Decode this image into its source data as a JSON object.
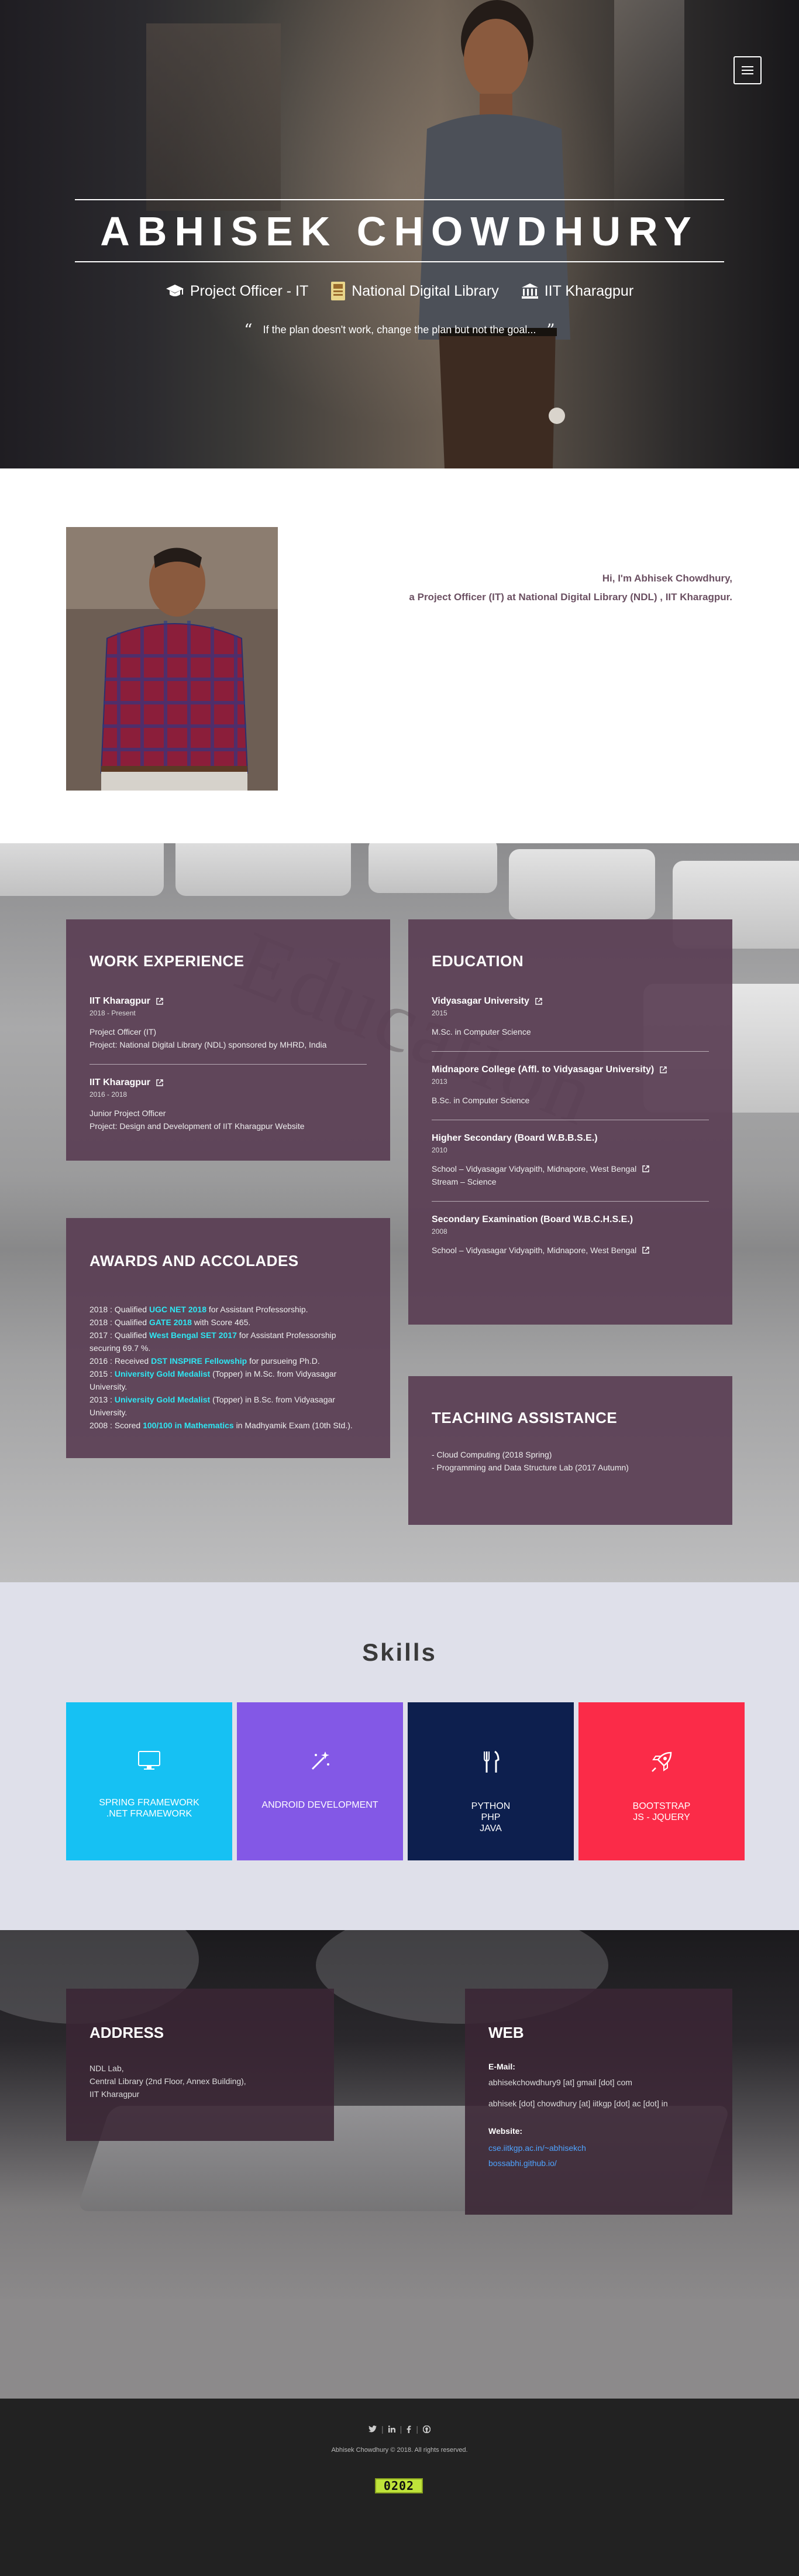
{
  "hero": {
    "name": "ABHISEK CHOWDHURY",
    "roles": [
      {
        "label": "Project Officer - IT",
        "icon": "graduation-cap-icon"
      },
      {
        "label": "National Digital Library",
        "icon": "library-icon"
      },
      {
        "label": "IIT Kharagpur",
        "icon": "university-icon"
      }
    ],
    "quote": "If the plan doesn't work, change the plan but not the goal..."
  },
  "about": {
    "line1": "Hi, I'm Abhisek Chowdhury,",
    "line2": "a Project Officer (IT) at National Digital Library (NDL) , IIT Kharagpur."
  },
  "work": {
    "title": "WORK EXPERIENCE",
    "items": [
      {
        "org": "IIT Kharagpur",
        "date": "2018 - Present",
        "role": "Project Officer (IT)",
        "project": "Project: National Digital Library (NDL) sponsored by MHRD, India"
      },
      {
        "org": "IIT Kharagpur",
        "date": "2016 - 2018",
        "role": "Junior Project Officer",
        "project": "Project: Design and Development of IIT Kharagpur Website"
      }
    ]
  },
  "awards": {
    "title": "AWARDS AND ACCOLADES",
    "items": [
      {
        "pre": "2018 : Qualified ",
        "hl": "UGC NET 2018",
        "post": " for Assistant Professorship."
      },
      {
        "pre": "2018 : Qualified ",
        "hl": "GATE 2018",
        "post": " with Score 465."
      },
      {
        "pre": "2017 : Qualified ",
        "hl": "West Bengal SET 2017",
        "post": " for Assistant Professorship securing 69.7 %."
      },
      {
        "pre": "2016 : Received ",
        "hl": "DST INSPIRE Fellowship",
        "post": " for pursueing Ph.D."
      },
      {
        "pre": "2015 : ",
        "hl": "University Gold Medalist",
        "post": " (Topper) in M.Sc. from Vidyasagar University."
      },
      {
        "pre": "2013 : ",
        "hl": "University Gold Medalist",
        "post": " (Topper) in B.Sc. from Vidyasagar University."
      },
      {
        "pre": "2008 : Scored ",
        "hl": "100/100 in Mathematics",
        "post": " in Madhyamik Exam (10th Std.)."
      }
    ]
  },
  "education": {
    "title": "EDUCATION",
    "items": [
      {
        "school": "Vidyasagar University",
        "year": "2015",
        "line1": "M.Sc. in Computer Science",
        "line2": ""
      },
      {
        "school": "Midnapore College (Affl. to Vidyasagar University)",
        "year": "2013",
        "line1": "B.Sc. in Computer Science",
        "line2": ""
      },
      {
        "school": "Higher Secondary (Board W.B.B.S.E.)",
        "year": "2010",
        "line1": "School – Vidyasagar Vidyapith, Midnapore, West Bengal",
        "line2": "Stream – Science"
      },
      {
        "school": "Secondary Examination (Board W.B.C.H.S.E.)",
        "year": "2008",
        "line1": "School – Vidyasagar Vidyapith, Midnapore, West Bengal",
        "line2": ""
      }
    ]
  },
  "teaching": {
    "title": "TEACHING ASSISTANCE",
    "items": [
      "- Cloud Computing (2018 Spring)",
      "- Programming and Data Structure Lab (2017 Autumn)"
    ]
  },
  "skills": {
    "title": "Skills",
    "items": [
      {
        "icon": "monitor-icon",
        "lines": [
          "SPRING FRAMEWORK",
          ".NET FRAMEWORK"
        ],
        "color": "#16c1f3"
      },
      {
        "icon": "magic-wand-icon",
        "lines": [
          "ANDROID DEVELOPMENT"
        ],
        "color": "#8358e6"
      },
      {
        "icon": "utensils-icon",
        "lines": [
          "PYTHON",
          "PHP",
          "JAVA"
        ],
        "color": "#0d1f4e"
      },
      {
        "icon": "rocket-icon",
        "lines": [
          "BOOTSTRAP",
          "JS - JQUERY"
        ],
        "color": "#fb2b48"
      }
    ]
  },
  "address": {
    "title": "ADDRESS",
    "lines": [
      "NDL Lab,",
      "Central Library (2nd Floor, Annex Building),",
      "IIT Kharagpur"
    ]
  },
  "web": {
    "title": "WEB",
    "email_label": "E-Mail:",
    "emails": [
      "abhisekchowdhury9 [at] gmail [dot] com",
      "abhisek [dot] chowdhury [at] iitkgp [dot] ac [dot] in"
    ],
    "website_label": "Website:",
    "websites": [
      "cse.iitkgp.ac.in/~abhisekch",
      "bossabhi.github.io/"
    ]
  },
  "footer": {
    "copyright": "Abhisek Chowdhury © 2018. All rights reserved.",
    "counter": "0202",
    "social_icons": [
      "twitter-icon",
      "linkedin-icon",
      "facebook-icon",
      "github-icon"
    ]
  },
  "colors": {
    "card": "#5a3e54",
    "highlight": "#2ee6f2",
    "link": "#4ea3ff",
    "footer": "#222222"
  }
}
